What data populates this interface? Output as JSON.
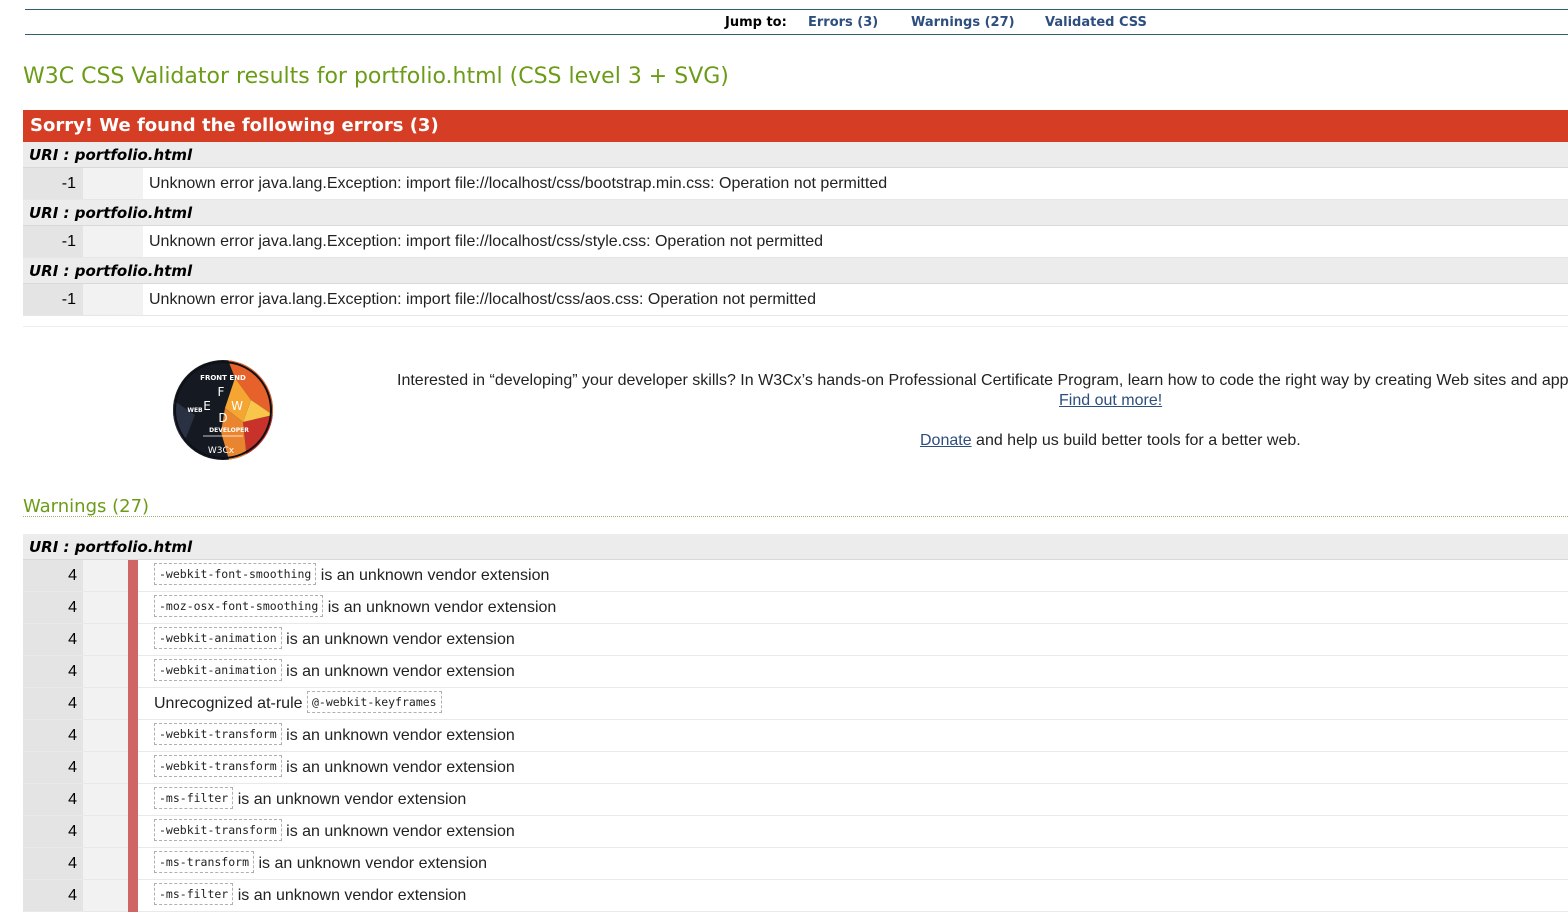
{
  "jumpbar": {
    "label": "Jump to:",
    "errors_link": "Errors (3)",
    "warnings_link": "Warnings (27)",
    "validated_link": "Validated CSS"
  },
  "title": "W3C CSS Validator results for portfolio.html (CSS level 3 + SVG)",
  "errors": {
    "header": "Sorry! We found the following errors (3)",
    "uri_label": "URI : portfolio.html",
    "items": [
      {
        "line": "-1",
        "message": "Unknown error java.lang.Exception: import file://localhost/css/bootstrap.min.css: Operation not permitted"
      },
      {
        "line": "-1",
        "message": "Unknown error java.lang.Exception: import file://localhost/css/style.css: Operation not permitted"
      },
      {
        "line": "-1",
        "message": "Unknown error java.lang.Exception: import file://localhost/css/aos.css: Operation not permitted"
      }
    ]
  },
  "promo": {
    "logo_name": "front-end-web-developer-badge",
    "logo_lettering": [
      "FRONT END",
      "WEB",
      "DEVELOPER",
      "F",
      "E",
      "W",
      "D",
      "W3Cx"
    ],
    "text": "Interested in “developing” your developer skills? In W3Cx’s hands-on Professional Certificate Program, learn how to code the right way by creating Web sites and apps",
    "find_out_more": "Find out more!",
    "donate_link": "Donate",
    "donate_rest": " and help us build better tools for a better web."
  },
  "warnings": {
    "heading": "Warnings (27)",
    "uri_label": "URI : portfolio.html",
    "items": [
      {
        "line": "4",
        "code": "-webkit-font-smoothing",
        "prefix": "",
        "suffix": " is an unknown vendor extension"
      },
      {
        "line": "4",
        "code": "-moz-osx-font-smoothing",
        "prefix": "",
        "suffix": " is an unknown vendor extension"
      },
      {
        "line": "4",
        "code": "-webkit-animation",
        "prefix": "",
        "suffix": " is an unknown vendor extension"
      },
      {
        "line": "4",
        "code": "-webkit-animation",
        "prefix": "",
        "suffix": " is an unknown vendor extension"
      },
      {
        "line": "4",
        "code": "@-webkit-keyframes",
        "prefix": "Unrecognized at-rule ",
        "suffix": ""
      },
      {
        "line": "4",
        "code": "-webkit-transform",
        "prefix": "",
        "suffix": " is an unknown vendor extension"
      },
      {
        "line": "4",
        "code": "-webkit-transform",
        "prefix": "",
        "suffix": " is an unknown vendor extension"
      },
      {
        "line": "4",
        "code": "-ms-filter",
        "prefix": "",
        "suffix": " is an unknown vendor extension"
      },
      {
        "line": "4",
        "code": "-webkit-transform",
        "prefix": "",
        "suffix": " is an unknown vendor extension"
      },
      {
        "line": "4",
        "code": "-ms-transform",
        "prefix": "",
        "suffix": " is an unknown vendor extension"
      },
      {
        "line": "4",
        "code": "-ms-filter",
        "prefix": "",
        "suffix": " is an unknown vendor extension"
      }
    ]
  },
  "colors": {
    "title_green": "#6c9c17",
    "error_red": "#d53e25",
    "warning_bar": "#cf6565",
    "link_blue": "#2d4e7e"
  }
}
